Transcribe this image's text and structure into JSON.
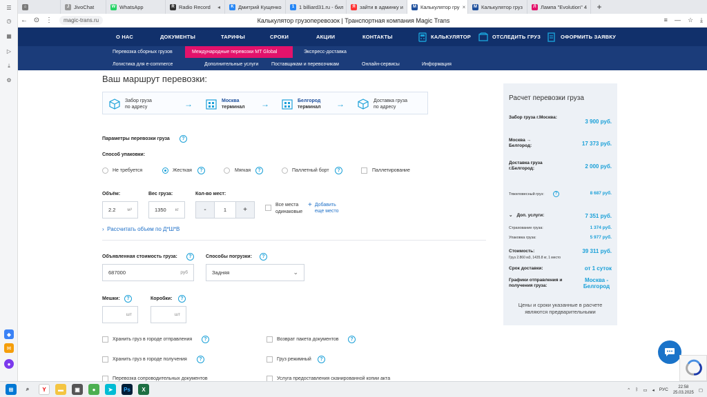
{
  "browser": {
    "tabs": [
      {
        "label": "",
        "color": "#7a7a7a",
        "glyph": "⌂"
      },
      {
        "label": "JivoChat",
        "color": "#999999",
        "glyph": "J"
      },
      {
        "label": "WhatsApp",
        "color": "#25d366",
        "glyph": "W"
      },
      {
        "label": "Radio Record",
        "color": "#333333",
        "glyph": "R"
      },
      {
        "label": "Дмитрий Кущенко",
        "color": "#2787f5",
        "glyph": "K"
      },
      {
        "label": "1 billiard31.ru - бил",
        "color": "#2787f5",
        "glyph": "1"
      },
      {
        "label": "зайти в админку и",
        "color": "#ff3333",
        "glyph": "Я"
      },
      {
        "label": "Калькулятор гру",
        "color": "#1d4f9c",
        "glyph": "M",
        "active": true
      },
      {
        "label": "Калькулятор груз",
        "color": "#1d4f9c",
        "glyph": "M"
      },
      {
        "label": "Лампа \"Evolution\" 4",
        "color": "#e3126b",
        "glyph": "Л"
      }
    ],
    "url": "magic-trans.ru",
    "page_title": "Калькулятор грузоперевозок | Транспортная компания Magic Trans"
  },
  "nav": {
    "items": [
      "О НАС",
      "ДОКУМЕНТЫ",
      "ТАРИФЫ",
      "СРОКИ",
      "АКЦИИ",
      "КОНТАКТЫ"
    ],
    "calculator": "КАЛЬКУЛЯТОР",
    "track": "ОТСЛЕДИТЬ ГРУЗ",
    "order": "ОФОРМИТЬ ЗАЯВКУ"
  },
  "subnav": {
    "row1": [
      "Перевозка сборных грузов",
      "Международные перевозки MT Global",
      "Экспресс-доставка"
    ],
    "row2": [
      "Логистика для e-commerce",
      "Дополнительные услуги",
      "Поставщикам и перевозчикам",
      "Онлайн-сервисы",
      "Информация"
    ]
  },
  "route": {
    "heading": "Ваш маршрут перевозки:",
    "steps": [
      {
        "line1": "Забор груза",
        "line2": "по адресу",
        "link": false
      },
      {
        "line1": "Москва",
        "line2": "терминал",
        "link": true
      },
      {
        "line1": "Белгород",
        "line2": "терминал",
        "link": true
      },
      {
        "line1": "Доставка груза",
        "line2": "по адресу",
        "link": false
      }
    ]
  },
  "params": {
    "title": "Параметры перевозки груза",
    "packing_label": "Способ упаковки:",
    "packing_options": [
      "Не требуется",
      "Жесткая",
      "Мягкая",
      "Паллетный борт",
      "Паллетирование"
    ],
    "packing_selected": "Жесткая",
    "volume_label": "Объём:",
    "volume_value": "2.2",
    "volume_unit": "м³",
    "weight_label": "Вес груза:",
    "weight_value": "1350",
    "weight_unit": "кг",
    "places_label": "Кол-во мест:",
    "places_value": "1",
    "minus": "-",
    "plus": "+",
    "same_places_line1": "Все места",
    "same_places_line2": "одинаковые",
    "add_place_line1": "Добавить",
    "add_place_line2": "еще место",
    "calc_volume": "Рассчитать объем по Д*Ш*В",
    "declared_label": "Объявленная стоимость груза:",
    "declared_value": "687000",
    "declared_unit": "руб",
    "loading_label": "Способы погрузки:",
    "loading_value": "Задняя",
    "bags_label": "Мешки:",
    "boxes_label": "Коробки:",
    "pcs_unit": "шт",
    "services": [
      "Хранить груз в городе отправления",
      "Хранить груз в городе получения",
      "Перевозка сопроводительных документов",
      "Возврат пакета документов",
      "Груз режимный",
      "Услуга предоставления сканированной копии акта"
    ]
  },
  "summary": {
    "title": "Расчет перевозки груза",
    "pickup_label": "Забор груза г.Москва:",
    "pickup_value": "3 900 руб.",
    "linehaul_label": "Москва → Белгород:",
    "linehaul_value": "17 373 руб.",
    "delivery_label": "Доставка груза г.Белгород:",
    "delivery_value": "2 000 руб.",
    "heavy_label": "Тяжеловесный груз:",
    "heavy_value": "8 687 руб.",
    "extra_label": "Доп. услуги:",
    "extra_value": "7 351 руб.",
    "insurance_label": "Страхование груза:",
    "insurance_value": "1 374 руб.",
    "packing_label": "Упаковка груза:",
    "packing_value": "5 977 руб.",
    "total_label": "Стоимость:",
    "total_value": "39 311 руб.",
    "total_note": "Груз 2.860 м3, 1435.8 кг, 1 место",
    "term_label": "Срок доставки:",
    "term_value": "от 1 суток",
    "schedule_label": "Графики отправления и получения груза:",
    "schedule_value": "Москва - Белгород",
    "note": "Цены и сроки указанные в расчете являются предварительными"
  },
  "taskbar": {
    "lang": "РУС",
    "time": "22:58",
    "date": "25.03.2025"
  }
}
